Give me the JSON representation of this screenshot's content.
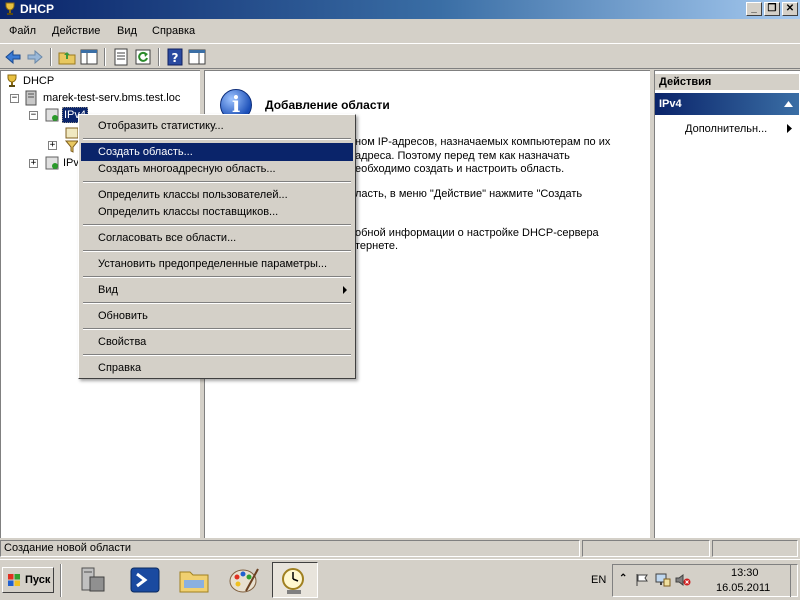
{
  "window": {
    "title": "DHCP",
    "buttons": {
      "minimize": "_",
      "restore": "❐",
      "close": "✕"
    }
  },
  "menubar": [
    "Файл",
    "Действие",
    "Вид",
    "Справка"
  ],
  "tree": {
    "root": "DHCP",
    "server": "marek-test-serv.bms.test.loc",
    "ipv4": "IPv4",
    "ipv6": "IPv"
  },
  "center": {
    "title": "Добавление области",
    "lines": [
      "ном IP-адресов, назначаемых компьютерам по их",
      "адреса. Поэтому перед тем как назначать",
      "еобходимо создать и настроить область.",
      "ласть, в меню \"Действие\" нажмите \"Создать",
      "обной информации о настройке DHCP-сервера",
      "тернете."
    ]
  },
  "actions": {
    "header": "Действия",
    "section": "IPv4",
    "item": "Дополнительн..."
  },
  "context_menu": {
    "items": [
      "Отобразить статистику...",
      "Создать область...",
      "Создать многоадресную область...",
      "Определить классы пользователей...",
      "Определить классы поставщиков...",
      "Согласовать все области...",
      "Установить предопределенные параметры...",
      "Вид",
      "Обновить",
      "Свойства",
      "Справка"
    ],
    "selected": "Создать область..."
  },
  "statusbar": {
    "text": "Создание новой области"
  },
  "taskbar": {
    "start_label": "Пуск",
    "language": "EN",
    "time": "13:30",
    "date": "16.05.2011"
  },
  "colors": {
    "selection": "#0a246a",
    "titlebar": "#0a246a",
    "face": "#d4d0c8"
  }
}
